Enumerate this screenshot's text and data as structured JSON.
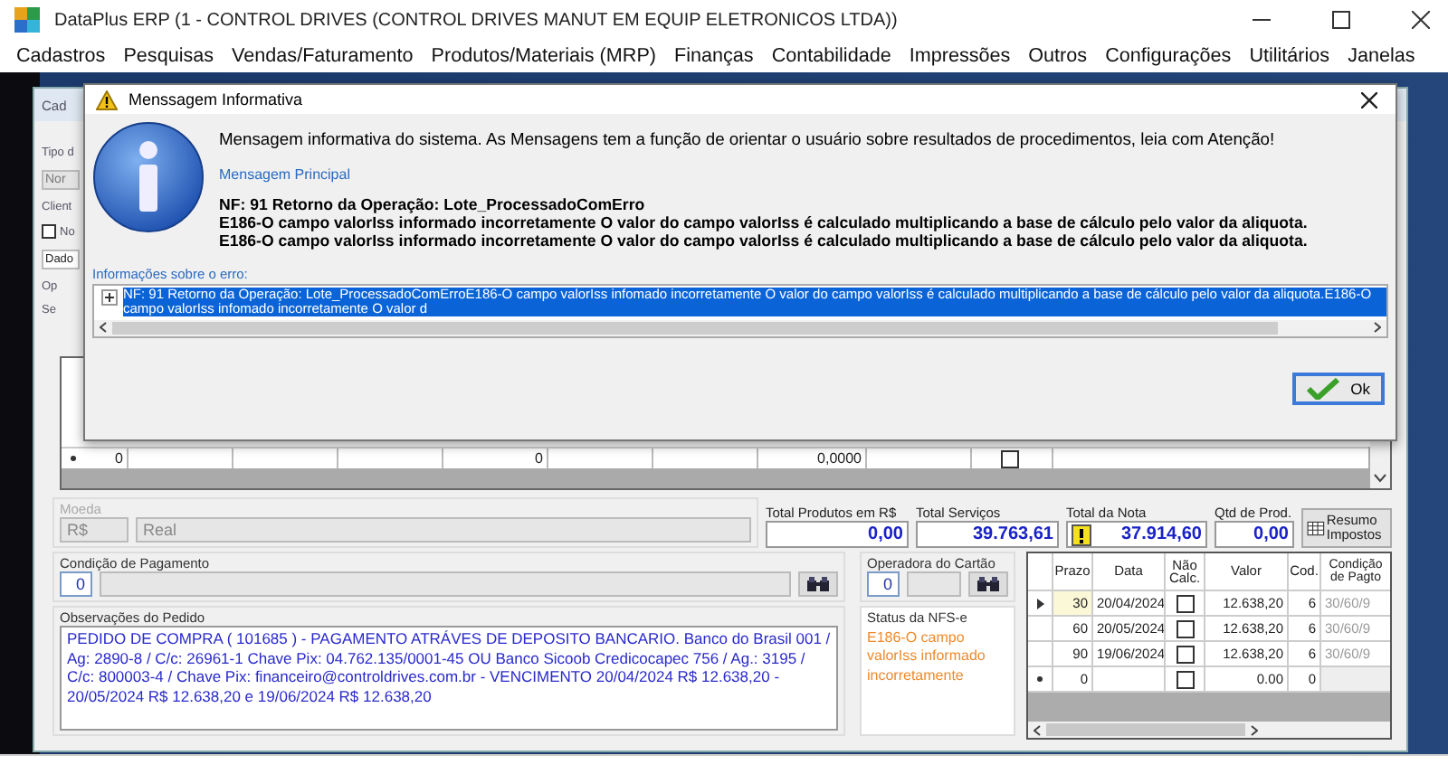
{
  "window": {
    "title": "DataPlus ERP (1 - CONTROL DRIVES  (CONTROL DRIVES MANUT EM EQUIP ELETRONICOS LTDA))"
  },
  "menu": [
    "Cadastros",
    "Pesquisas",
    "Vendas/Faturamento",
    "Produtos/Materiais (MRP)",
    "Finanças",
    "Contabilidade",
    "Impressões",
    "Outros",
    "Configurações",
    "Utilitários",
    "Janelas"
  ],
  "form": {
    "title": "Cad",
    "fragments": [
      {
        "kind": "label",
        "text": "Tipo d"
      },
      {
        "kind": "field",
        "text": "Nor"
      },
      {
        "kind": "label",
        "text": "Client"
      },
      {
        "kind": "checkbox",
        "text": "No",
        "checked": false
      },
      {
        "kind": "tab",
        "text": "Dado"
      },
      {
        "kind": "label",
        "text": "Op"
      },
      {
        "kind": "label",
        "text": "Se"
      }
    ],
    "items_grid": {
      "new_row": {
        "values": [
          "0",
          "0",
          "0,0000"
        ],
        "checked": false
      }
    },
    "currency": {
      "label": "Moeda",
      "disabled": true,
      "code": "R$",
      "name": "Real"
    },
    "totals": [
      {
        "label": "Total Produtos em R$",
        "value": "0,00",
        "warning": false
      },
      {
        "label": "Total Serviços",
        "value": "39.763,61",
        "warning": false
      },
      {
        "label": "Total da Nota",
        "value": "37.914,60",
        "warning": true
      },
      {
        "label": "Qtd de Prod.",
        "value": "0,00",
        "warning": false
      }
    ],
    "summary_button": "Resumo Impostos",
    "payment_condition": {
      "label": "Condição de Pagamento",
      "code": "0"
    },
    "card_operator": {
      "label": "Operadora do Cartão",
      "code": "0"
    },
    "notes": {
      "label": "Observações do Pedido",
      "text": "PEDIDO DE COMPRA ( 101685 ) - PAGAMENTO ATRÁVES DE DEPOSITO BANCARIO. Banco do Brasil 001 /  Ag: 2890-8 / C/c: 26961-1 Chave Pix: 04.762.135/0001-45 OU Banco Sicoob Credicocapec 756 / Ag.: 3195 /  C/c: 800003-4 / Chave Pix: financeiro@controldrives.com.br - VENCIMENTO 20/04/2024 R$ 12.638,20 - 20/05/2024 R$ 12.638,20 e 19/06/2024 R$ 12.638,20"
    },
    "nfse_status": {
      "label": "Status da NFS-e",
      "text": "E186-O campo valorIss informado incorretamente"
    },
    "installments": {
      "columns": [
        "Prazo",
        "Data",
        "Não Calc.",
        "Valor",
        "Cod.",
        "Condição de Pagto"
      ],
      "rows": [
        {
          "kind": "current",
          "prazo": "30",
          "data": "20/04/2024",
          "nao_calc": false,
          "valor": "12.638,20",
          "cod": "6",
          "condicao": "30/60/9"
        },
        {
          "kind": "normal",
          "prazo": "60",
          "data": "20/05/2024",
          "nao_calc": false,
          "valor": "12.638,20",
          "cod": "6",
          "condicao": "30/60/9"
        },
        {
          "kind": "normal",
          "prazo": "90",
          "data": "19/06/2024",
          "nao_calc": false,
          "valor": "12.638,20",
          "cod": "6",
          "condicao": "30/60/9"
        },
        {
          "kind": "new",
          "prazo": "0",
          "data": "",
          "nao_calc": false,
          "valor": "0.00",
          "cod": "0",
          "condicao": ""
        }
      ]
    }
  },
  "dialog": {
    "title": "Menssagem Informativa",
    "intro": "Mensagem informativa do sistema. As Mensagens tem a função de orientar o usuário sobre resultados de procedimentos, leia com Atenção!",
    "section_label": "Mensagem Principal",
    "message_lines": [
      "NF: 91 Retorno da Operação: Lote_ProcessadoComErro",
      "E186-O campo valorIss informado incorretamente O valor do campo valorIss é  calculado multiplicando a base de cálculo pelo valor da aliquota.",
      "E186-O campo valorIss informado incorretamente O valor do campo valorIss é  calculado multiplicando a base de cálculo pelo valor da aliquota."
    ],
    "details_label": "Informações sobre o erro:",
    "details_row": {
      "text": "NF: 91 Retorno da Operação: Lote_ProcessadoComErroE186-O campo valorIss infomado incorretamente O valor do campo valorIss é  calculado multiplicando a base de cálculo pelo valor da aliquota.E186-O campo valorIss infomado incorretamente O valor d",
      "selected": true,
      "expanded": false
    },
    "ok_button": "Ok"
  }
}
